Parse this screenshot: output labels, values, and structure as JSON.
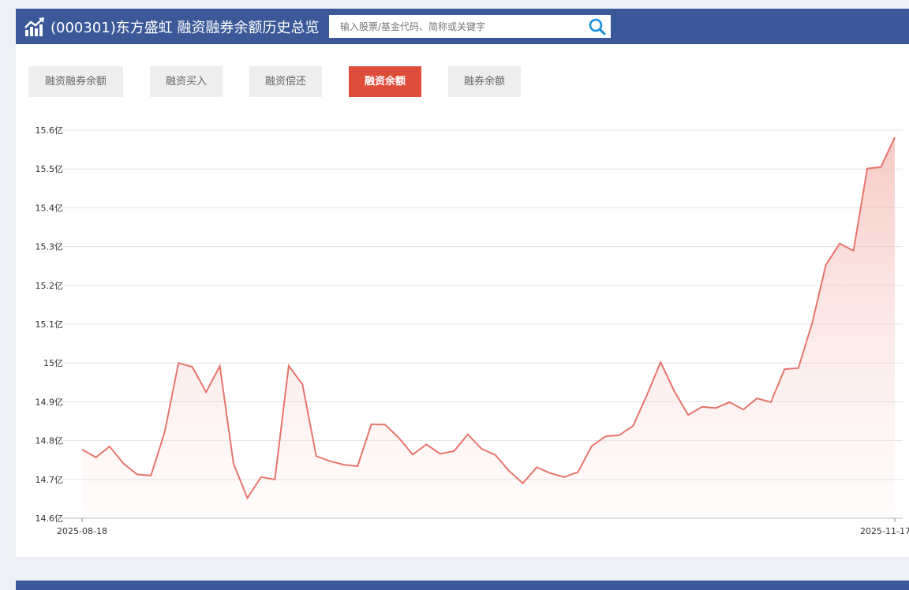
{
  "header": {
    "title": "(000301)东方盛虹 融资融券余额历史总览",
    "search_placeholder": "输入股票/基金代码、简称或关键字",
    "logo_icon": "chart-up-icon",
    "search_icon": "search-icon",
    "bg_color": "#3b5998"
  },
  "tabs": [
    {
      "label": "融资融券余额",
      "active": false
    },
    {
      "label": "融资买入",
      "active": false
    },
    {
      "label": "融资偿还",
      "active": false
    },
    {
      "label": "融资余额",
      "active": true
    },
    {
      "label": "融券余额",
      "active": false
    }
  ],
  "chart_data": {
    "type": "area",
    "title": "",
    "xlabel": "",
    "ylabel": "",
    "x_tick_labels": [
      "2025-08-18",
      "2025-11-17"
    ],
    "y_ticks": [
      14.6,
      14.7,
      14.8,
      14.9,
      15.0,
      15.1,
      15.2,
      15.3,
      15.4,
      15.5,
      15.6
    ],
    "y_tick_labels": [
      "14.6亿",
      "14.7亿",
      "14.8亿",
      "14.9亿",
      "15亿",
      "15.1亿",
      "15.2亿",
      "15.3亿",
      "15.4亿",
      "15.5亿",
      "15.6亿"
    ],
    "ylim": [
      14.6,
      15.6
    ],
    "grid": true,
    "line_color": "#e8756b",
    "series": [
      {
        "values": [
          14.777,
          14.757,
          14.785,
          14.741,
          14.713,
          14.71,
          14.822,
          15.0,
          14.99,
          14.925,
          14.992,
          14.74,
          14.652,
          14.706,
          14.7,
          14.993,
          14.945,
          14.76,
          14.747,
          14.738,
          14.734,
          14.842,
          14.841,
          14.807,
          14.764,
          14.79,
          14.766,
          14.773,
          14.816,
          14.779,
          14.763,
          14.722,
          14.69,
          14.731,
          14.716,
          14.706,
          14.719,
          14.786,
          14.811,
          14.814,
          14.838,
          14.917,
          15.002,
          14.927,
          14.866,
          14.887,
          14.884,
          14.899,
          14.88,
          14.909,
          14.899,
          14.984,
          14.987,
          15.103,
          15.253,
          15.308,
          15.289,
          15.501,
          15.505,
          15.582
        ]
      }
    ]
  }
}
